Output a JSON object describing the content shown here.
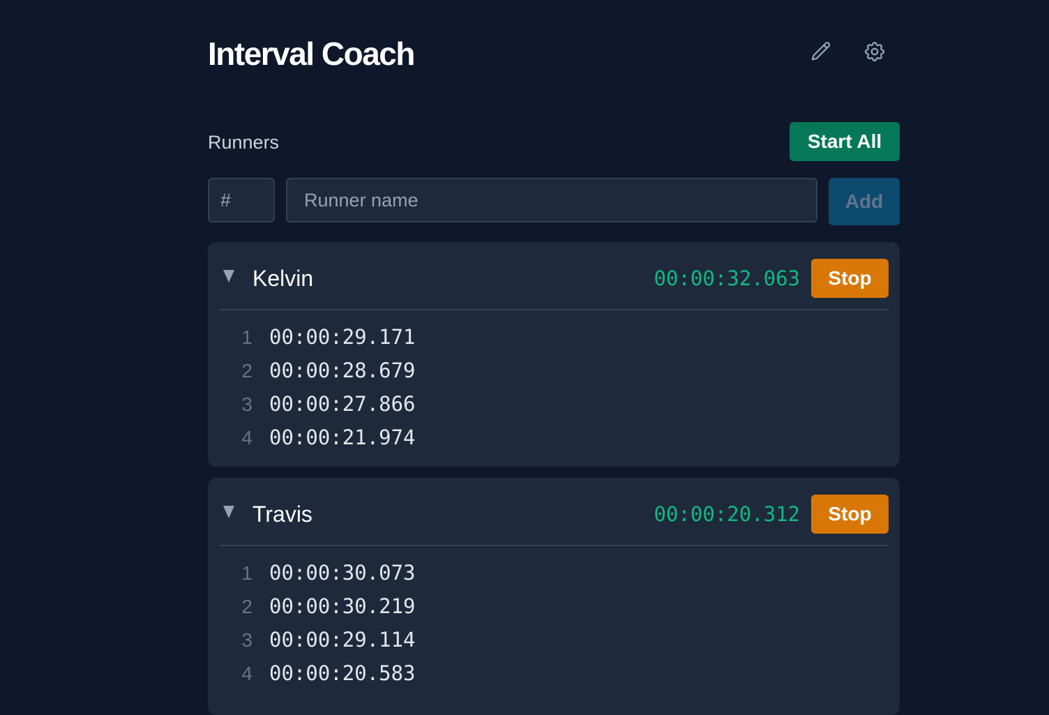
{
  "app": {
    "title": "Interval Coach",
    "icons": {
      "edit": "pencil-icon",
      "settings": "gear-icon"
    }
  },
  "runners_section": {
    "label": "Runners",
    "start_all_label": "Start All"
  },
  "add_form": {
    "number_placeholder": "#",
    "name_placeholder": "Runner name",
    "add_label": "Add"
  },
  "runners": [
    {
      "name": "Kelvin",
      "elapsed": "00:00:32.063",
      "action_label": "Stop",
      "laps": [
        {
          "n": "1",
          "time": "00:00:29.171"
        },
        {
          "n": "2",
          "time": "00:00:28.679"
        },
        {
          "n": "3",
          "time": "00:00:27.866"
        },
        {
          "n": "4",
          "time": "00:00:21.974"
        }
      ]
    },
    {
      "name": "Travis",
      "elapsed": "00:00:20.312",
      "action_label": "Stop",
      "laps": [
        {
          "n": "1",
          "time": "00:00:30.073"
        },
        {
          "n": "2",
          "time": "00:00:30.219"
        },
        {
          "n": "3",
          "time": "00:00:29.114"
        },
        {
          "n": "4",
          "time": "00:00:20.583"
        }
      ]
    }
  ],
  "colors": {
    "background": "#0f172a",
    "card": "#1e293b",
    "start_all": "#047857",
    "stop": "#d97706",
    "timer": "#10b981",
    "add": "#0c4a6e"
  }
}
